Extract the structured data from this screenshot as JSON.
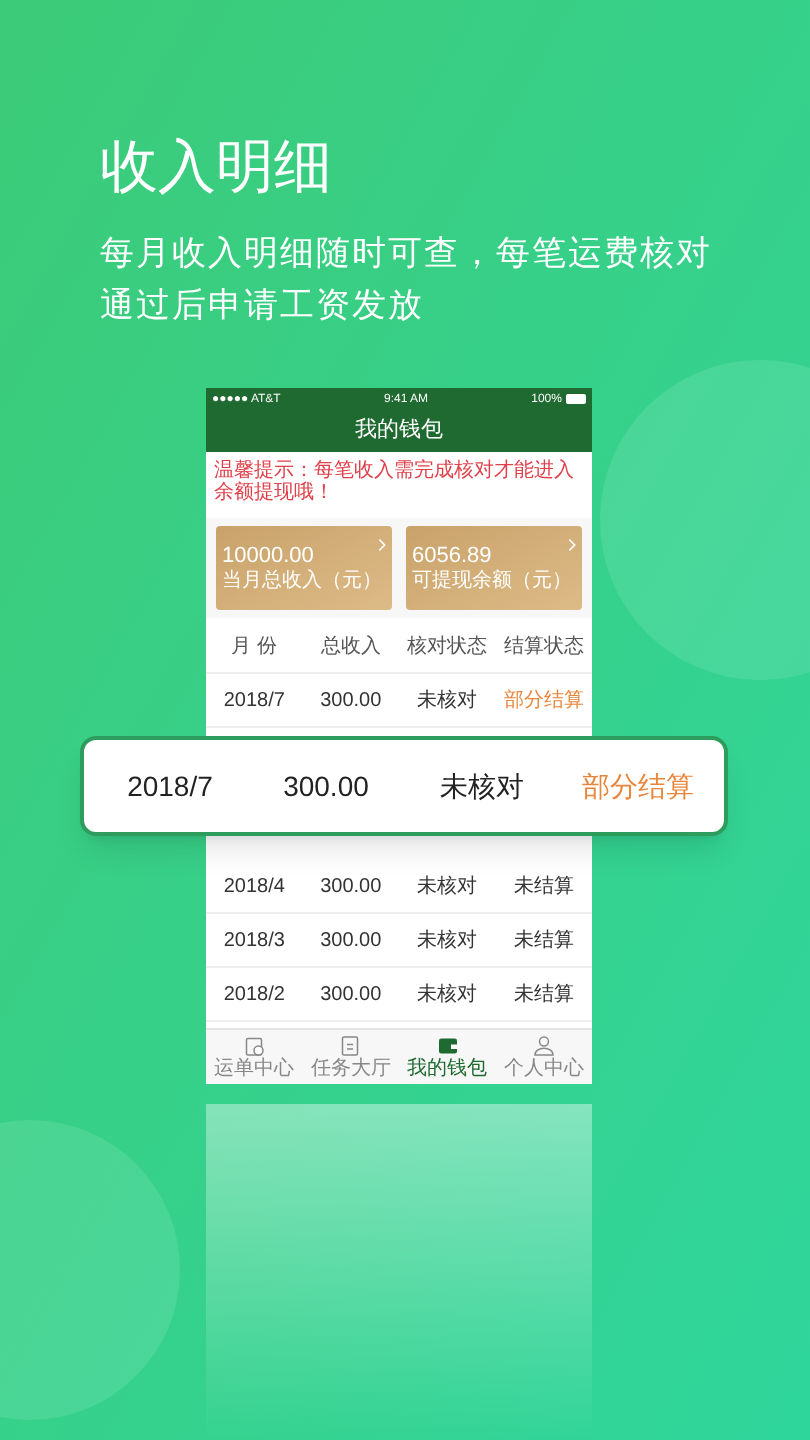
{
  "headline": "收入明细",
  "description": [
    "每月收入明细随时可查，每笔运费核对",
    "通过后申请工资发放"
  ],
  "phone": {
    "status_bar": {
      "carrier": "●●●●● AT&T",
      "time": "9:41 AM",
      "battery": "100%"
    },
    "title": "我的钱包",
    "notice": "温馨提示：每笔收入需完成核对才能进入余额提现哦！",
    "cards": [
      {
        "amount": "10000.00",
        "label": "当月总收入（元）"
      },
      {
        "amount": "6056.89",
        "label": "可提现余额（元）"
      }
    ],
    "table": {
      "columns": [
        "月 份",
        "总收入",
        "核对状态",
        "结算状态"
      ],
      "rows": [
        {
          "month": "2018/7",
          "income": "300.00",
          "check": "未核对",
          "settle": "部分结算",
          "color": "#e8873c"
        },
        {
          "month": "2018/4",
          "income": "300.00",
          "check": "未核对",
          "settle": "未结算",
          "color": "#333333"
        },
        {
          "month": "2018/3",
          "income": "300.00",
          "check": "未核对",
          "settle": "未结算",
          "color": "#333333"
        },
        {
          "month": "2018/2",
          "income": "300.00",
          "check": "未核对",
          "settle": "未结算",
          "color": "#333333"
        }
      ]
    },
    "tabs": [
      {
        "label": "运单中心",
        "selected": false
      },
      {
        "label": "任务大厅",
        "selected": false
      },
      {
        "label": "我的钱包",
        "selected": true
      },
      {
        "label": "个人中心",
        "selected": false
      }
    ]
  },
  "highlight_row": {
    "month": "2018/7",
    "income": "300.00",
    "check": "未核对",
    "settle": "部分结算",
    "color": "#e8873c"
  }
}
